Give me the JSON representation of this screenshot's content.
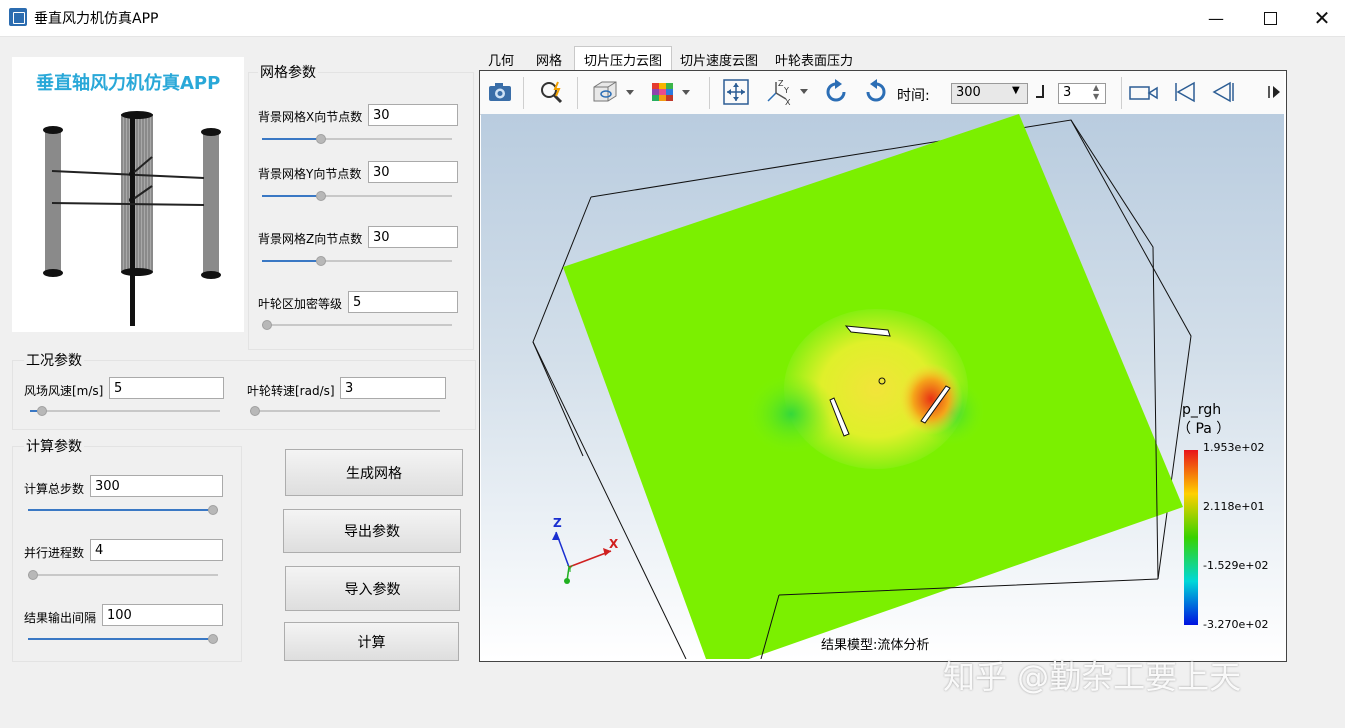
{
  "window": {
    "title": "垂直风力机仿真APP"
  },
  "logo": {
    "caption": "垂直轴风力机仿真APP"
  },
  "mesh": {
    "title": "网格参数",
    "x_label": "背景网格X向节点数",
    "x_value": "30",
    "x_level": 0.3,
    "y_label": "背景网格Y向节点数",
    "y_value": "30",
    "y_level": 0.3,
    "z_label": "背景网格Z向节点数",
    "z_value": "30",
    "z_level": 0.3,
    "refine_label": "叶轮区加密等级",
    "refine_value": "5",
    "refine_level": 0.0
  },
  "conditions": {
    "title": "工况参数",
    "wind_label": "风场风速[m/s]",
    "wind_value": "5",
    "wind_level": 0.04,
    "rot_label": "叶轮转速[rad/s]",
    "rot_value": "3",
    "rot_level": 0.0
  },
  "calc": {
    "title": "计算参数",
    "steps_label": "计算总步数",
    "steps_value": "300",
    "steps_level": 1.0,
    "procs_label": "并行进程数",
    "procs_value": "4",
    "procs_level": 0.0,
    "interval_label": "结果输出间隔",
    "interval_value": "100",
    "interval_level": 1.0
  },
  "buttons": {
    "generate_mesh": "生成网格",
    "export_params": "导出参数",
    "import_params": "导入参数",
    "compute": "计算"
  },
  "tabs": [
    "几何",
    "网格",
    "切片压力云图",
    "切片速度云图",
    "叶轮表面压力"
  ],
  "active_tab": 2,
  "toolbar": {
    "time_label": "时间:",
    "time_value": "300",
    "step_value": "3",
    "icons": [
      "camera-icon",
      "query-icon",
      "box-view-icon",
      "color-cube-icon",
      "fit-view-icon",
      "axes-icon",
      "rotate-cw-icon",
      "rotate-ccw-icon",
      "record-icon",
      "first-frame-icon",
      "prev-frame-icon",
      "next-frame-icon"
    ]
  },
  "viewport": {
    "result_label": "结果模型:流体分析",
    "watermark": "知乎 @勤杂工要上天",
    "axis_x": "X",
    "axis_y": "Y",
    "axis_z": "Z"
  },
  "legend": {
    "title_line1": "p_rgh",
    "title_line2": "（ Pa ）",
    "max": "1.953e+02",
    "mid_high": "2.118e+01",
    "mid_low": "-1.529e+02",
    "min": "-3.270e+02",
    "colors": [
      "#e8141a",
      "#ffd000",
      "#38d200",
      "#00d8d8",
      "#0012e0"
    ]
  },
  "colors": {
    "accent": "#3a78c4",
    "field_green": "#7bf000",
    "logo_text": "#29a8d8"
  }
}
